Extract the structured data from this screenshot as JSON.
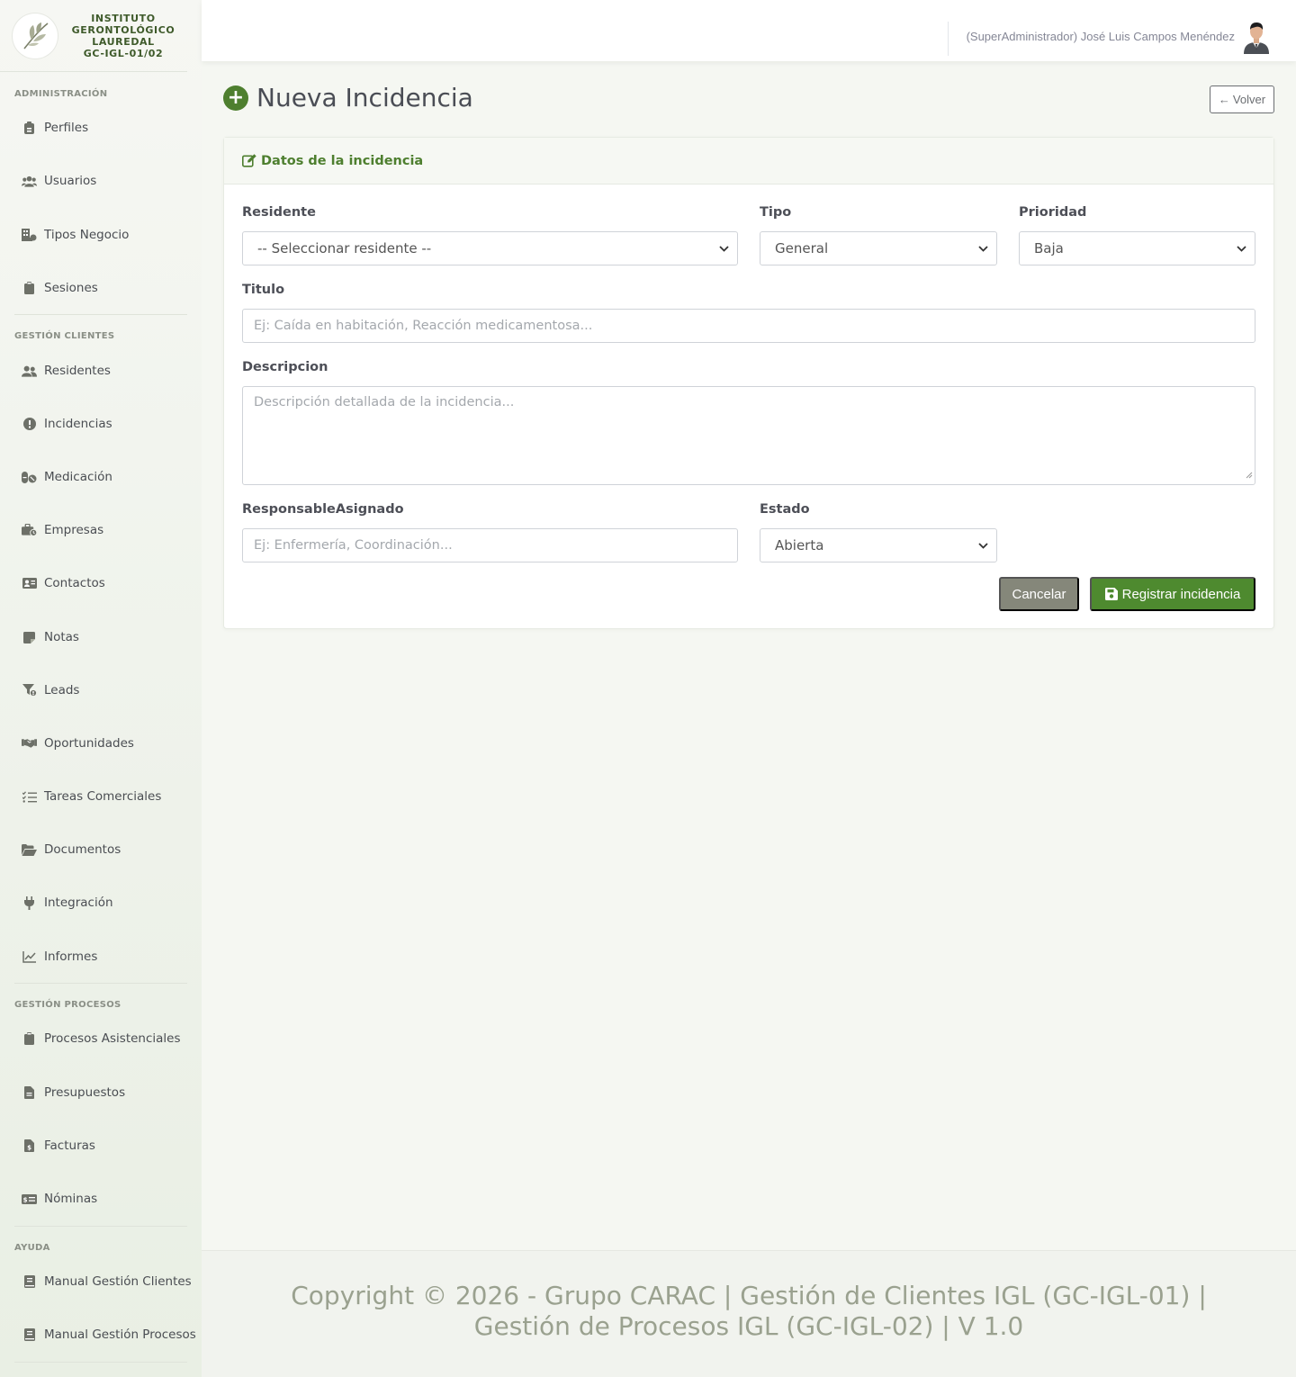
{
  "brand": {
    "lines": [
      "INSTITUTO",
      "GERONTOLÓGICO",
      "LAUREDAL",
      "GC-IGL-01/02"
    ]
  },
  "sidebar": {
    "sections": [
      {
        "label": "Administración",
        "items": [
          {
            "label": "Perfiles",
            "icon": "id-badge-icon"
          },
          {
            "label": "Usuarios",
            "icon": "users-icon"
          },
          {
            "label": "Tipos Negocio",
            "icon": "building-icon"
          },
          {
            "label": "Sesiones",
            "icon": "clipboard-icon"
          }
        ]
      },
      {
        "label": "Gestión Clientes",
        "items": [
          {
            "label": "Residentes",
            "icon": "user-friends-icon"
          },
          {
            "label": "Incidencias",
            "icon": "exclamation-circle-icon"
          },
          {
            "label": "Medicación",
            "icon": "pills-icon"
          },
          {
            "label": "Empresas",
            "icon": "briefcase-icon"
          },
          {
            "label": "Contactos",
            "icon": "address-card-icon"
          },
          {
            "label": "Notas",
            "icon": "sticky-note-icon"
          },
          {
            "label": "Leads",
            "icon": "filter-icon"
          },
          {
            "label": "Oportunidades",
            "icon": "handshake-icon"
          },
          {
            "label": "Tareas Comerciales",
            "icon": "tasks-icon"
          },
          {
            "label": "Documentos",
            "icon": "folder-open-icon"
          },
          {
            "label": "Integración",
            "icon": "plug-icon"
          },
          {
            "label": "Informes",
            "icon": "chart-line-icon"
          }
        ]
      },
      {
        "label": "Gestión Procesos",
        "items": [
          {
            "label": "Procesos Asistenciales",
            "icon": "clipboard-icon"
          },
          {
            "label": "Presupuestos",
            "icon": "file-alt-icon"
          },
          {
            "label": "Facturas",
            "icon": "file-invoice-icon"
          },
          {
            "label": "Nóminas",
            "icon": "money-check-icon"
          }
        ]
      },
      {
        "label": "Ayuda",
        "items": [
          {
            "label": "Manual Gestión Clientes",
            "icon": "book-icon"
          },
          {
            "label": "Manual Gestión Procesos",
            "icon": "book-icon"
          }
        ]
      }
    ]
  },
  "topbar": {
    "user": "(SuperAdministrador) José Luis Campos Menéndez"
  },
  "page": {
    "title": "Nueva Incidencia",
    "back_label": "Volver"
  },
  "form": {
    "card_title": "Datos de la incidencia",
    "residente": {
      "label": "Residente",
      "value": "-- Seleccionar residente --"
    },
    "tipo": {
      "label": "Tipo",
      "value": "General"
    },
    "prioridad": {
      "label": "Prioridad",
      "value": "Baja"
    },
    "titulo": {
      "label": "Titulo",
      "placeholder": "Ej: Caída en habitación, Reacción medicamentosa..."
    },
    "descripcion": {
      "label": "Descripcion",
      "placeholder": "Descripción detallada de la incidencia..."
    },
    "responsable": {
      "label": "ResponsableAsignado",
      "placeholder": "Ej: Enfermería, Coordinación..."
    },
    "estado": {
      "label": "Estado",
      "value": "Abierta"
    },
    "cancel_label": "Cancelar",
    "submit_label": "Registrar incidencia"
  },
  "footer": {
    "text": "Copyright © 2026 - Grupo CARAC | Gestión de Clientes IGL (GC-IGL-01) | Gestión de Procesos IGL (GC-IGL-02) | V 1.0"
  },
  "colors": {
    "accent": "#4e7f2f",
    "cancel": "#85877a",
    "background": "#f5f7f2"
  }
}
